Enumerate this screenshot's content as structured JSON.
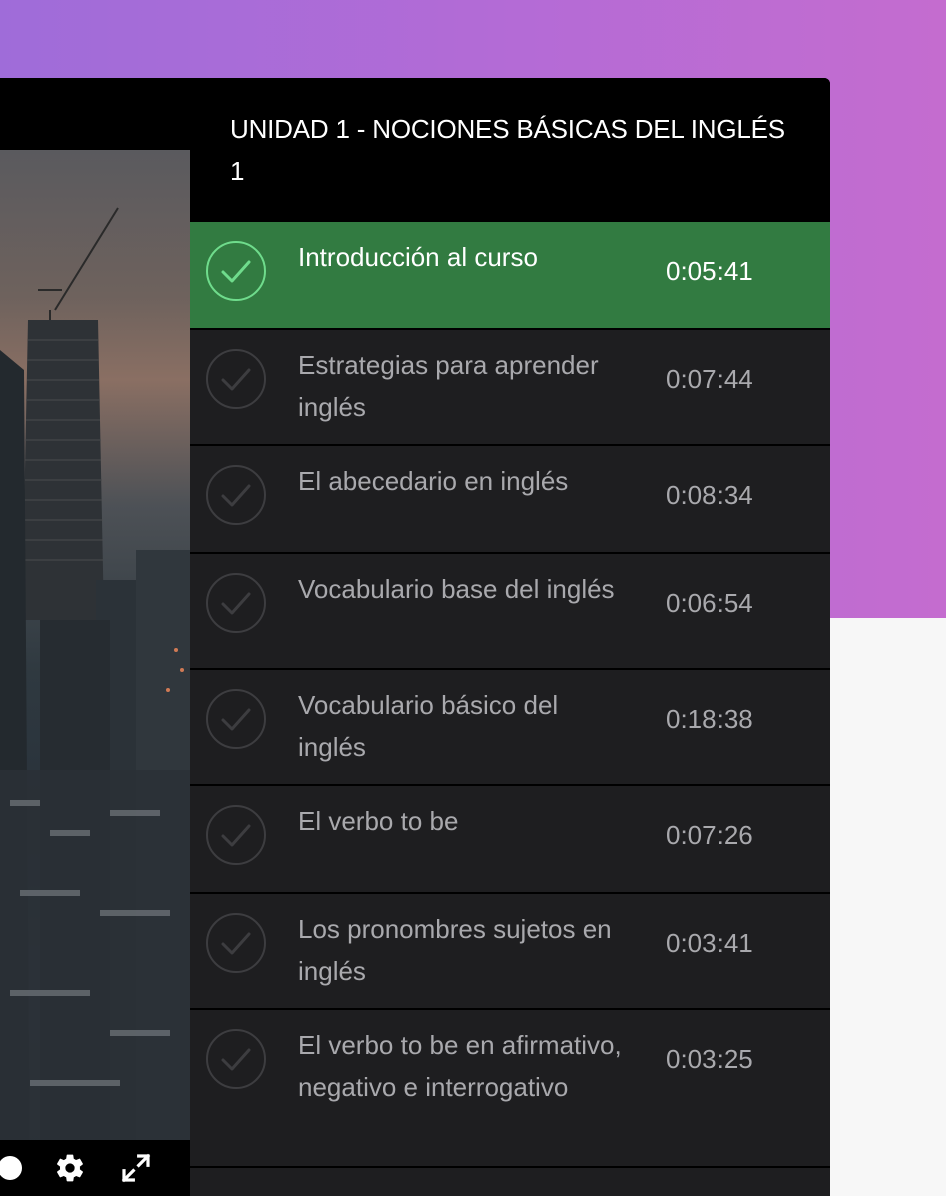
{
  "unit": {
    "title": "UNIDAD 1 - NOCIONES BÁSICAS DEL INGLÉS 1"
  },
  "lessons": [
    {
      "title": "Introducción al curso",
      "duration": "0:05:41",
      "completed": true,
      "active": true
    },
    {
      "title": "Estrategias para aprender inglés",
      "duration": "0:07:44",
      "completed": false,
      "active": false
    },
    {
      "title": "El abecedario en inglés",
      "duration": "0:08:34",
      "completed": false,
      "active": false
    },
    {
      "title": "Vocabulario base del inglés",
      "duration": "0:06:54",
      "completed": false,
      "active": false
    },
    {
      "title": "Vocabulario básico del inglés",
      "duration": "0:18:38",
      "completed": false,
      "active": false
    },
    {
      "title": "El verbo to be",
      "duration": "0:07:26",
      "completed": false,
      "active": false
    },
    {
      "title": "Los pronombres sujetos en inglés",
      "duration": "0:03:41",
      "completed": false,
      "active": false
    },
    {
      "title": "El verbo to be en afirmativo, negativo e interrogativo",
      "duration": "0:03:25",
      "completed": false,
      "active": false
    }
  ],
  "video": {
    "controls": [
      "progress-handle",
      "settings-icon",
      "fullscreen-icon"
    ]
  },
  "colors": {
    "active_lesson": "#327b41",
    "check_active": "#6fdc8c",
    "check_inactive": "#3d3d40",
    "panel_bg": "#1e1e20"
  }
}
